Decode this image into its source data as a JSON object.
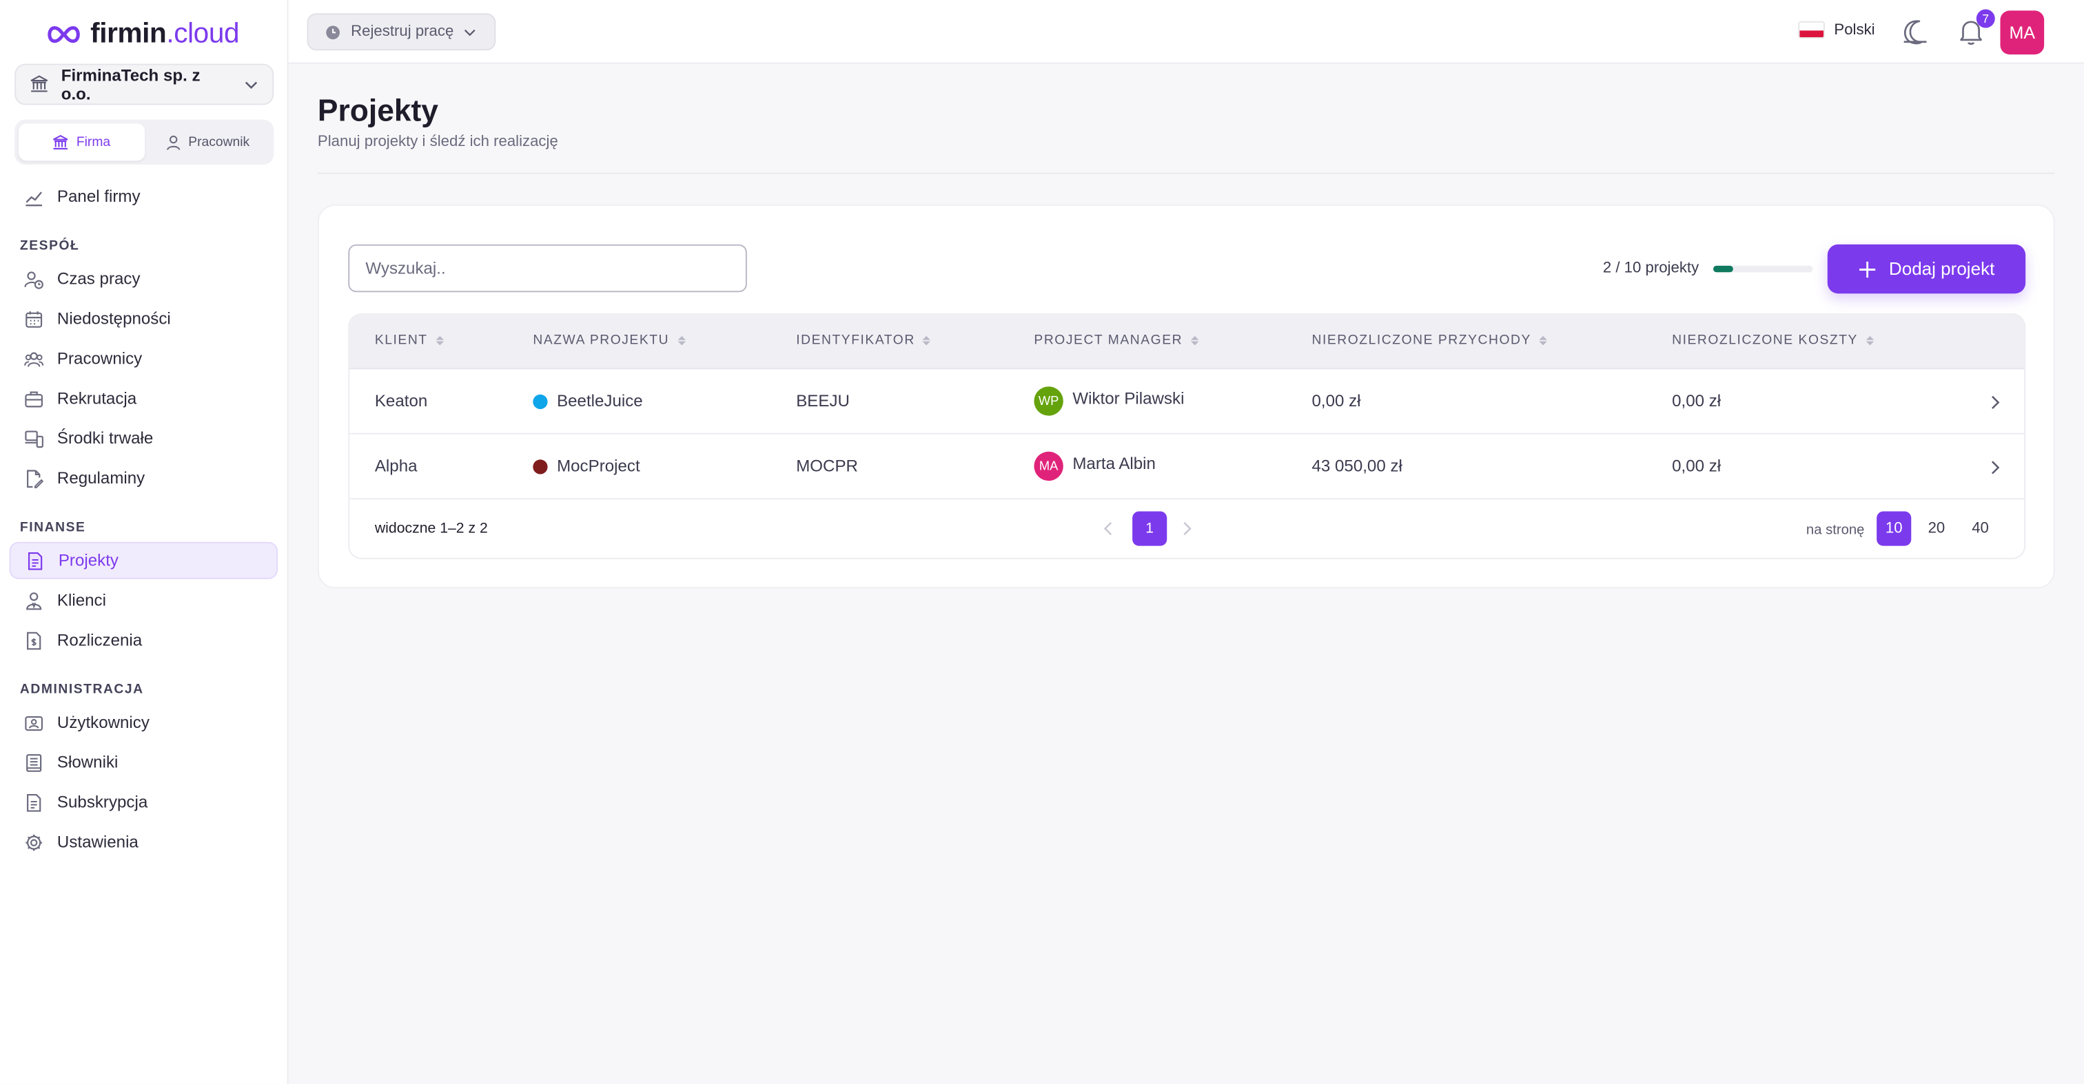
{
  "brand": {
    "name_part1": "firmin",
    "name_part2": ".cloud",
    "accent": "#7c3aed"
  },
  "company": {
    "name": "FirminaTech sp. z o.o."
  },
  "mode_switch": {
    "company": "Firma",
    "employee": "Pracownik",
    "active": "Firma"
  },
  "sidebar": {
    "top_item": {
      "label": "Panel firmy",
      "icon": "chart-icon"
    },
    "sections": [
      {
        "title": "ZESPÓŁ",
        "items": [
          {
            "label": "Czas pracy",
            "icon": "user-clock-icon"
          },
          {
            "label": "Niedostępności",
            "icon": "calendar-icon"
          },
          {
            "label": "Pracownicy",
            "icon": "users-icon"
          },
          {
            "label": "Rekrutacja",
            "icon": "briefcase-icon"
          },
          {
            "label": "Środki trwałe",
            "icon": "devices-icon"
          },
          {
            "label": "Regulaminy",
            "icon": "document-edit-icon"
          }
        ]
      },
      {
        "title": "FINANSE",
        "items": [
          {
            "label": "Projekty",
            "icon": "document-icon",
            "active": true
          },
          {
            "label": "Klienci",
            "icon": "user-icon"
          },
          {
            "label": "Rozliczenia",
            "icon": "invoice-icon"
          }
        ]
      },
      {
        "title": "ADMINISTRACJA",
        "items": [
          {
            "label": "Użytkownicy",
            "icon": "id-card-icon"
          },
          {
            "label": "Słowniki",
            "icon": "book-icon"
          },
          {
            "label": "Subskrypcja",
            "icon": "receipt-icon"
          },
          {
            "label": "Ustawienia",
            "icon": "gear-icon"
          }
        ]
      }
    ]
  },
  "topbar": {
    "register_label": "Rejestruj pracę",
    "language": "Polski",
    "notifications_count": "7",
    "user_initials": "MA"
  },
  "page": {
    "title": "Projekty",
    "subtitle": "Planuj projekty i śledź ich realizację"
  },
  "toolbar": {
    "search_placeholder": "Wyszukaj..",
    "quota_text": "2 / 10 projekty",
    "quota_fraction": 0.2,
    "add_label": "Dodaj projekt"
  },
  "table": {
    "columns": [
      "KLIENT",
      "NAZWA PROJEKTU",
      "IDENTYFIKATOR",
      "PROJECT MANAGER",
      "NIEROZLICZONE PRZYCHODY",
      "NIEROZLICZONE KOSZTY"
    ],
    "rows": [
      {
        "client": "Keaton",
        "project": "BeetleJuice",
        "color": "#0ea5e9",
        "id": "BEEJU",
        "pm_initials": "WP",
        "pm_color": "#65a30d",
        "pm_name": "Wiktor Pilawski",
        "revenue": "0,00 zł",
        "costs": "0,00 zł"
      },
      {
        "client": "Alpha",
        "project": "MocProject",
        "color": "#7f1d1d",
        "id": "MOCPR",
        "pm_initials": "MA",
        "pm_color": "#e0237a",
        "pm_name": "Marta Albin",
        "revenue": "43 050,00 zł",
        "costs": "0,00 zł"
      }
    ],
    "footer": {
      "visible_text": "widoczne 1–2 z 2",
      "current_page": "1",
      "per_page_label": "na stronę",
      "per_page_options": [
        "10",
        "20",
        "40"
      ],
      "per_page_selected": "10"
    }
  }
}
